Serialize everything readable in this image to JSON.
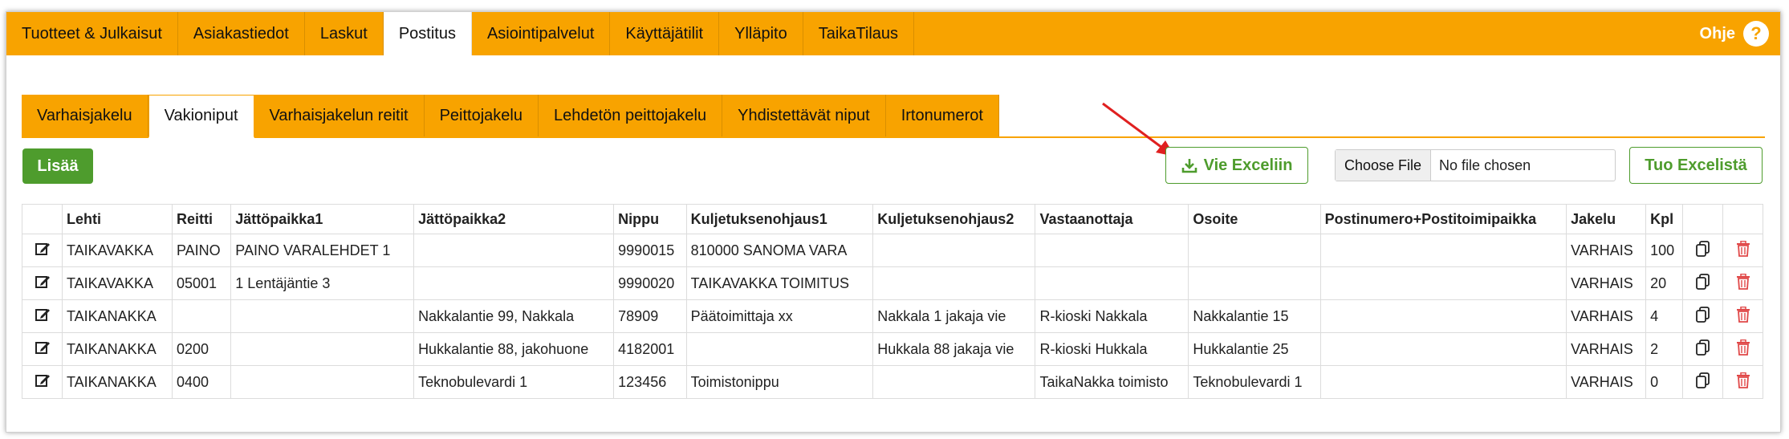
{
  "topnav": {
    "tabs": [
      {
        "label": "Tuotteet & Julkaisut",
        "active": false
      },
      {
        "label": "Asiakastiedot",
        "active": false
      },
      {
        "label": "Laskut",
        "active": false
      },
      {
        "label": "Postitus",
        "active": true
      },
      {
        "label": "Asiointipalvelut",
        "active": false
      },
      {
        "label": "Käyttäjätilit",
        "active": false
      },
      {
        "label": "Ylläpito",
        "active": false
      },
      {
        "label": "TaikaTilaus",
        "active": false
      }
    ],
    "help_label": "Ohje",
    "help_icon": "?"
  },
  "subtabs": [
    {
      "label": "Varhaisjakelu",
      "active": false
    },
    {
      "label": "Vakioniput",
      "active": true
    },
    {
      "label": "Varhaisjakelun reitit",
      "active": false
    },
    {
      "label": "Peittojakelu",
      "active": false
    },
    {
      "label": "Lehdetön peittojakelu",
      "active": false
    },
    {
      "label": "Yhdistettävät niput",
      "active": false
    },
    {
      "label": "Irtonumerot",
      "active": false
    }
  ],
  "toolbar": {
    "add_label": "Lisää",
    "export_label": "Vie Exceliin",
    "choose_file_label": "Choose File",
    "no_file_label": "No file chosen",
    "import_label": "Tuo Excelistä"
  },
  "colors": {
    "accent": "#f8a300",
    "green": "#4e9c2d",
    "delete": "#e04848",
    "arrow": "#e02020"
  },
  "table": {
    "headers": [
      "",
      "Lehti",
      "Reitti",
      "Jättöpaikka1",
      "Jättöpaikka2",
      "Nippu",
      "Kuljetuksenohjaus1",
      "Kuljetuksenohjaus2",
      "Vastaanottaja",
      "Osoite",
      "Postinumero+Postitoimipaikka",
      "Jakelu",
      "Kpl",
      "",
      ""
    ],
    "rows": [
      [
        "TAIKAVAKKA",
        "PAINO",
        "PAINO VARALEHDET 1",
        "",
        "9990015",
        "810000 SANOMA VARA",
        "",
        "",
        "",
        "",
        "VARHAIS",
        "100"
      ],
      [
        "TAIKAVAKKA",
        "05001",
        "1 Lentäjäntie 3",
        "",
        "9990020",
        "TAIKAVAKKA TOIMITUS",
        "",
        "",
        "",
        "",
        "VARHAIS",
        "20"
      ],
      [
        "TAIKANAKKA",
        "",
        "",
        "Nakkalantie 99, Nakkala",
        "78909",
        "Päätoimittaja xx",
        "Nakkala 1 jakaja vie",
        "R-kioski Nakkala",
        "Nakkalantie 15",
        "",
        "VARHAIS",
        "4"
      ],
      [
        "TAIKANAKKA",
        "0200",
        "",
        "Hukkalantie 88, jakohuone",
        "4182001",
        "",
        "Hukkala 88 jakaja vie",
        "R-kioski Hukkala",
        "Hukkalantie 25",
        "",
        "VARHAIS",
        "2"
      ],
      [
        "TAIKANAKKA",
        "0400",
        "",
        "Teknobulevardi 1",
        "123456",
        "Toimistonippu",
        "",
        "TaikaNakka toimisto",
        "Teknobulevardi 1",
        "",
        "VARHAIS",
        "0"
      ]
    ],
    "row_icons": [
      "edit-icon",
      "copy-icon",
      "trash-icon"
    ]
  }
}
